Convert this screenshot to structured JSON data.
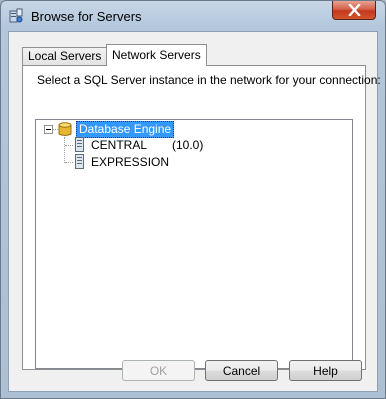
{
  "window": {
    "title": "Browse for Servers"
  },
  "tabs": [
    {
      "label": "Local Servers",
      "selected": false
    },
    {
      "label": "Network Servers",
      "selected": true
    }
  ],
  "panel": {
    "instruction": "Select a SQL Server instance in the network for your connection:"
  },
  "tree": {
    "root": {
      "label": "Database Engine",
      "expanded": true,
      "selected": true,
      "icon": "database-icon"
    },
    "servers": [
      {
        "name": "CENTRAL",
        "version": "(10.0)",
        "icon": "server-icon"
      },
      {
        "name": "EXPRESSION",
        "version": "",
        "icon": "server-icon"
      }
    ]
  },
  "buttons": {
    "ok_label": "OK",
    "ok_enabled": false,
    "cancel_label": "Cancel",
    "help_label": "Help"
  },
  "colors": {
    "selection": "#3399ff",
    "dialog_bg": "#f0f0f0",
    "close_button": "#c2391e"
  }
}
